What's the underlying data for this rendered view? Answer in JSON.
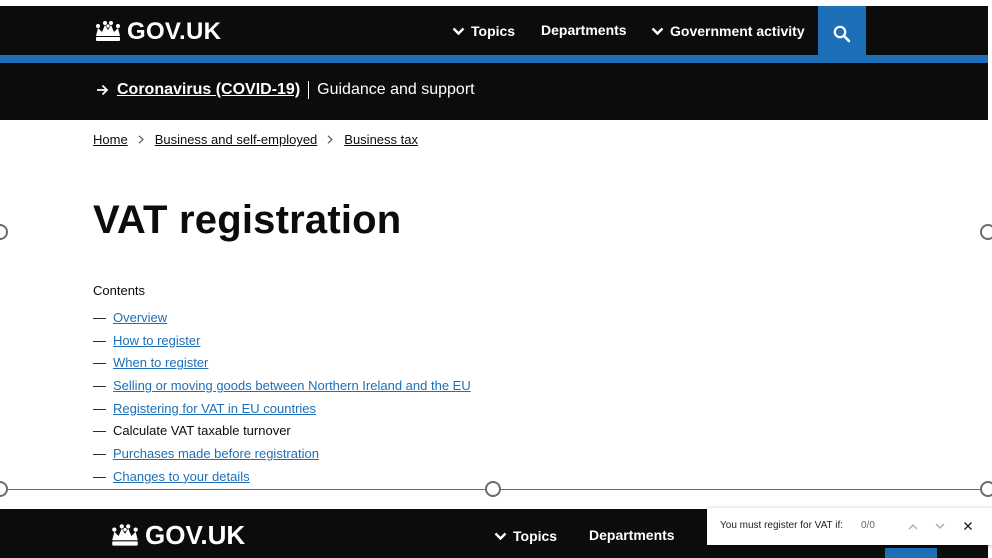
{
  "header": {
    "logo_text": "GOV.UK",
    "nav": [
      {
        "label": "Topics",
        "has_chevron": true
      },
      {
        "label": "Departments",
        "has_chevron": false
      },
      {
        "label": "Government activity",
        "has_chevron": true
      }
    ],
    "search_icon": "search-icon"
  },
  "banner": {
    "link": "Coronavirus (COVID-19)",
    "text": "Guidance and support"
  },
  "breadcrumb": [
    "Home",
    "Business and self-employed",
    "Business tax"
  ],
  "page_title": "VAT registration",
  "contents": {
    "label": "Contents",
    "items": [
      {
        "label": "Overview",
        "current": false
      },
      {
        "label": "How to register",
        "current": false
      },
      {
        "label": "When to register",
        "current": false
      },
      {
        "label": "Selling or moving goods between Northern Ireland and the EU",
        "current": false
      },
      {
        "label": "Registering for VAT in EU countries",
        "current": false
      },
      {
        "label": "Calculate VAT taxable turnover",
        "current": true
      },
      {
        "label": "Purchases made before registration",
        "current": false
      },
      {
        "label": "Changes to your details",
        "current": false
      }
    ]
  },
  "preview_header": {
    "logo_text": "GOV.UK",
    "nav": [
      "Topics",
      "Departments"
    ]
  },
  "find": {
    "query": "You must register for VAT if:",
    "count": "0/0"
  },
  "colors": {
    "black": "#0b0c0c",
    "brand_blue": "#1d70b8",
    "link_blue": "#1d70b8"
  }
}
